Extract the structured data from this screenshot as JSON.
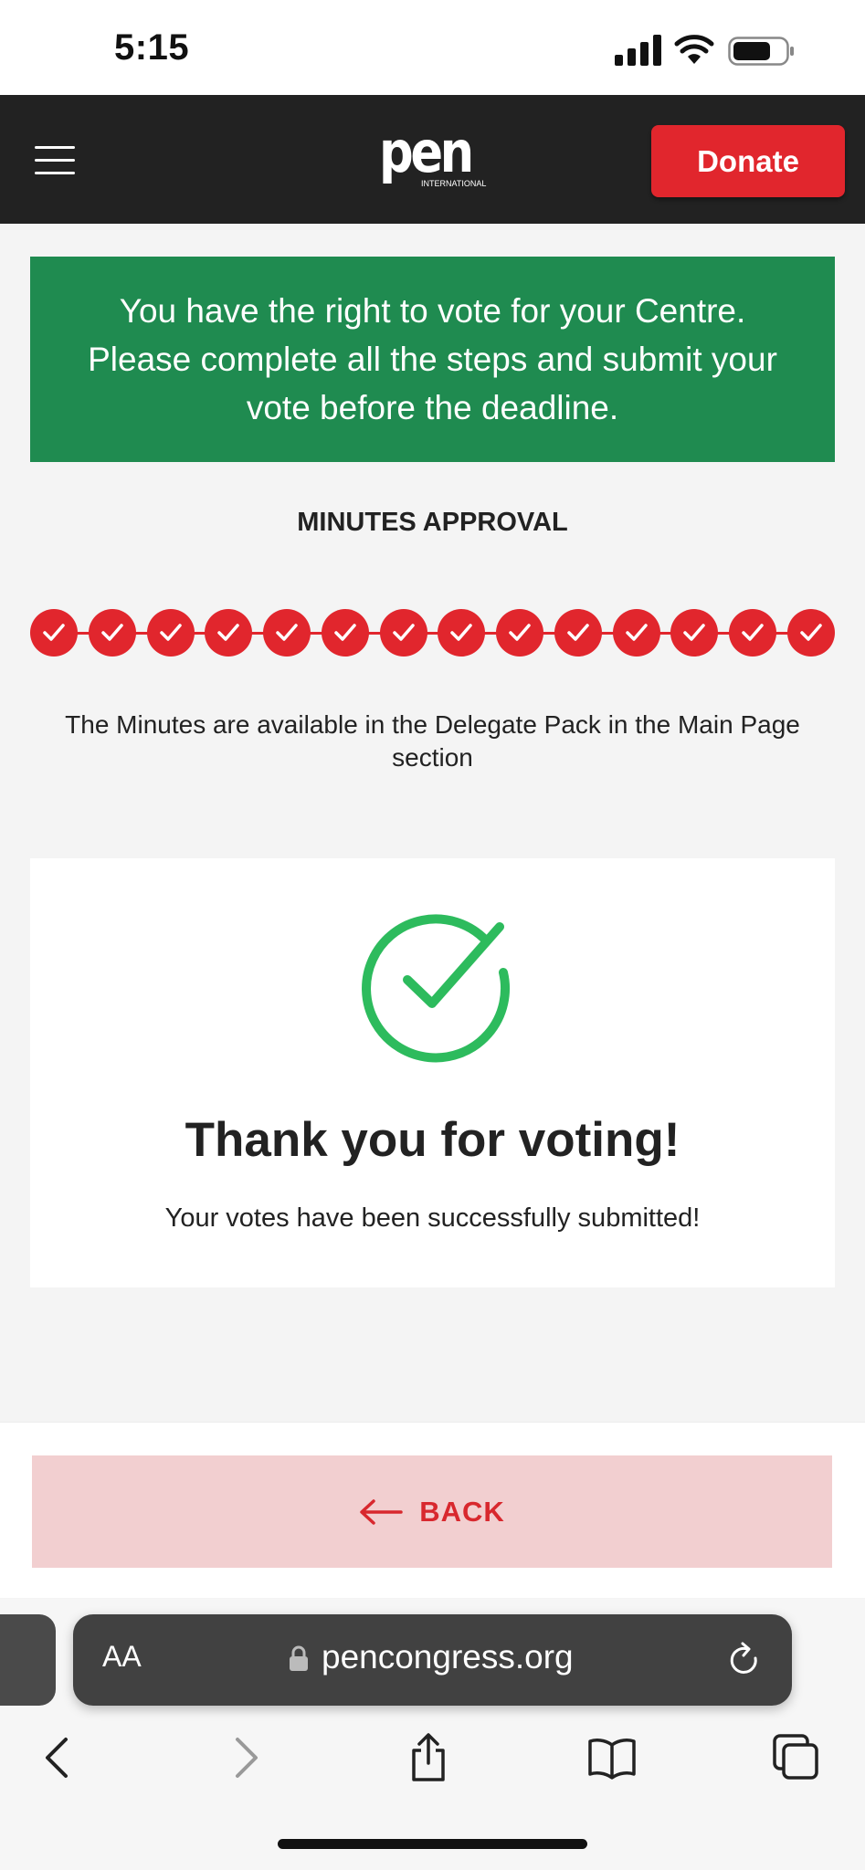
{
  "status_bar": {
    "time": "5:15"
  },
  "header": {
    "menu_icon": "hamburger-menu-icon",
    "logo": {
      "main": "pen",
      "sub": "INTERNATIONAL"
    },
    "donate_label": "Donate",
    "brand_red": "#e1262d",
    "header_bg": "#222222"
  },
  "banner": {
    "text": "You have the right to vote for your Centre. Please complete all the steps and submit your vote before the deadline.",
    "color": "#1f8b50"
  },
  "section_title": "MINUTES APPROVAL",
  "steps": {
    "total": 14,
    "completed": 14,
    "icon": "check-icon"
  },
  "minutes_note": "The Minutes are available in the Delegate Pack in the Main Page section",
  "success": {
    "icon": "check-circle-icon",
    "title": "Thank you for voting!",
    "message": "Your votes have been successfully submitted!",
    "icon_color": "#2dbb5d"
  },
  "back_button": {
    "label": "BACK",
    "icon": "arrow-left-icon"
  },
  "browser": {
    "aa_label": "AA",
    "url": "pencongress.org",
    "icons": [
      "lock-icon",
      "reload-icon",
      "back-icon",
      "forward-icon",
      "share-icon",
      "bookmarks-icon",
      "tabs-icon"
    ]
  }
}
